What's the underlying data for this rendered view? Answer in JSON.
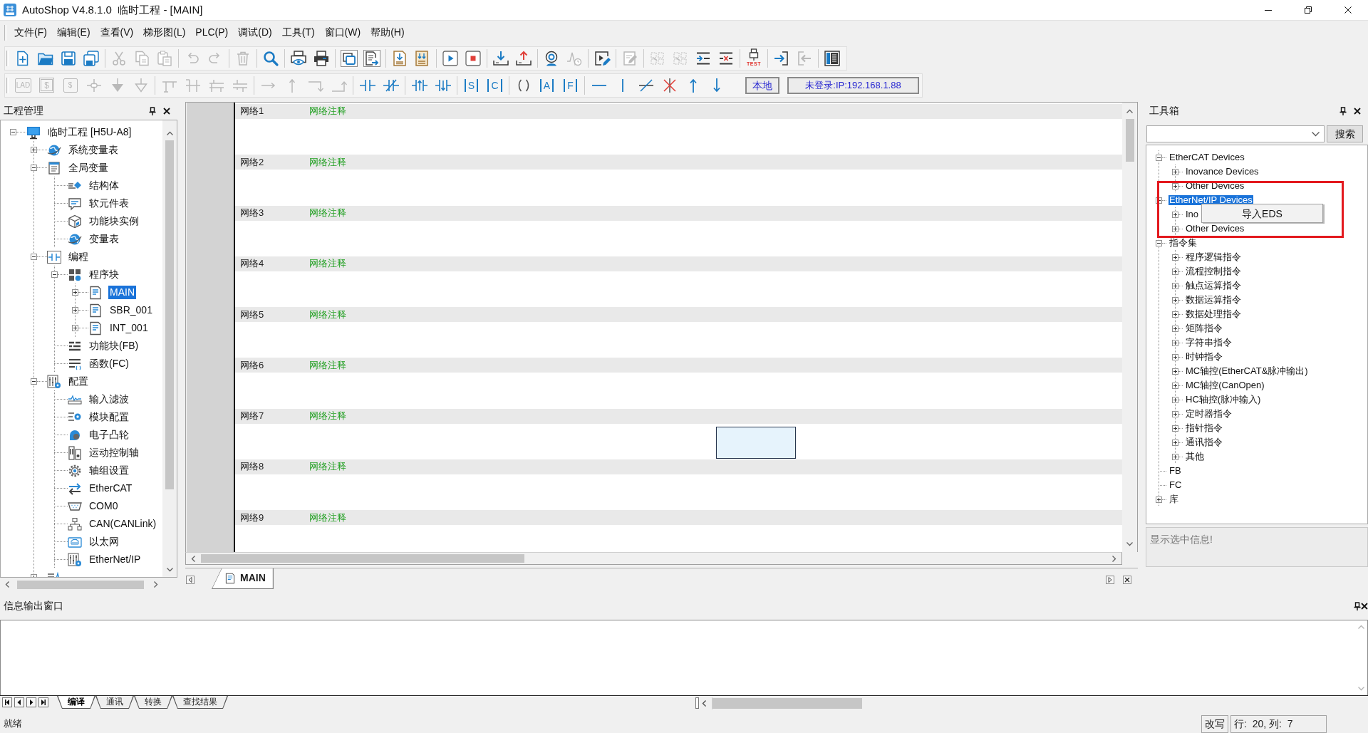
{
  "window": {
    "title": "AutoShop V4.8.1.0  临时工程 - [MAIN]"
  },
  "menu_bar": [
    "文件(F)",
    "编辑(E)",
    "查看(V)",
    "梯形图(L)",
    "PLC(P)",
    "调试(D)",
    "工具(T)",
    "窗口(W)",
    "帮助(H)"
  ],
  "toolbar_main": [
    [
      {
        "kind": "new",
        "disabled": false,
        "pressed": false
      },
      {
        "kind": "open",
        "disabled": false,
        "pressed": false
      },
      {
        "kind": "save",
        "disabled": false,
        "pressed": false
      },
      {
        "kind": "save_all",
        "disabled": false,
        "pressed": false
      }
    ],
    [
      {
        "kind": "cut",
        "disabled": true,
        "pressed": false
      },
      {
        "kind": "copy",
        "disabled": true,
        "pressed": false
      },
      {
        "kind": "paste",
        "disabled": true,
        "pressed": false
      }
    ],
    [
      {
        "kind": "undo",
        "disabled": true,
        "pressed": false
      },
      {
        "kind": "redo",
        "disabled": true,
        "pressed": false
      }
    ],
    [
      {
        "kind": "delete",
        "disabled": true,
        "pressed": false
      }
    ],
    [
      {
        "kind": "find",
        "disabled": false,
        "pressed": false
      }
    ],
    [
      {
        "kind": "print_preview",
        "disabled": false,
        "pressed": false
      },
      {
        "kind": "print",
        "disabled": false,
        "pressed": false
      }
    ],
    [
      {
        "kind": "windows",
        "disabled": false,
        "pressed": true
      },
      {
        "kind": "window_list",
        "disabled": false,
        "pressed": true
      }
    ],
    [
      {
        "kind": "import",
        "disabled": false,
        "pressed": false
      },
      {
        "kind": "compare",
        "disabled": false,
        "pressed": false
      }
    ],
    [
      {
        "kind": "run",
        "disabled": false,
        "pressed": false
      },
      {
        "kind": "stop",
        "disabled": false,
        "pressed": false
      }
    ],
    [
      {
        "kind": "download",
        "disabled": false,
        "pressed": false
      },
      {
        "kind": "upload",
        "disabled": false,
        "pressed": false
      }
    ],
    [
      {
        "kind": "monitor",
        "disabled": false,
        "pressed": false
      },
      {
        "kind": "trace",
        "disabled": true,
        "pressed": false
      }
    ],
    [
      {
        "kind": "online_edit",
        "disabled": false,
        "pressed": false
      }
    ],
    [
      {
        "kind": "comment",
        "disabled": true,
        "pressed": false
      }
    ],
    [
      {
        "kind": "grid",
        "disabled": true,
        "pressed": false
      },
      {
        "kind": "grid",
        "disabled": true,
        "pressed": false
      },
      {
        "kind": "insert_row",
        "disabled": false,
        "pressed": false
      },
      {
        "kind": "delete_row",
        "disabled": false,
        "pressed": false
      }
    ],
    [
      {
        "kind": "test",
        "label": "TEST",
        "disabled": false,
        "pressed": false
      }
    ],
    [
      {
        "kind": "login",
        "disabled": false,
        "pressed": false
      },
      {
        "kind": "logout",
        "disabled": true,
        "pressed": false
      }
    ],
    [
      {
        "kind": "panel",
        "disabled": false,
        "pressed": false
      }
    ]
  ],
  "toolbar_ladder": {
    "groups": [
      [
        {
          "kind": "boxed",
          "label": "LAD",
          "disabled": true
        },
        {
          "kind": "double_boxed",
          "label": "$",
          "disabled": true
        },
        {
          "kind": "boxed",
          "label": "$",
          "disabled": true
        },
        {
          "kind": "junction",
          "disabled": true
        },
        {
          "kind": "down_filled",
          "disabled": true
        },
        {
          "kind": "down_outline",
          "disabled": true
        }
      ],
      [
        {
          "kind": "branch_a",
          "disabled": true
        },
        {
          "kind": "branch_b",
          "disabled": true
        },
        {
          "kind": "branch_c",
          "disabled": true
        },
        {
          "kind": "branch_d",
          "disabled": true
        }
      ],
      [
        {
          "kind": "line_right",
          "disabled": true
        },
        {
          "kind": "line_up",
          "disabled": true
        },
        {
          "kind": "corner_down",
          "disabled": true
        },
        {
          "kind": "corner_up",
          "disabled": true
        }
      ],
      [
        {
          "kind": "contact",
          "disabled": false
        },
        {
          "kind": "contact_nc",
          "disabled": false
        }
      ],
      [
        {
          "kind": "rising",
          "disabled": false
        },
        {
          "kind": "falling",
          "disabled": false
        }
      ],
      [
        {
          "kind": "bracketed",
          "label": "S",
          "disabled": false
        },
        {
          "kind": "bracketed",
          "label": "C",
          "disabled": false
        }
      ],
      [
        {
          "kind": "coil",
          "disabled": false
        },
        {
          "kind": "bracketed",
          "label": "A",
          "disabled": false
        },
        {
          "kind": "bracketed",
          "label": "F",
          "disabled": false
        }
      ],
      [
        {
          "kind": "hline",
          "disabled": false
        },
        {
          "kind": "vline",
          "disabled": false
        },
        {
          "kind": "slash",
          "disabled": false
        },
        {
          "kind": "delete_line",
          "disabled": false
        },
        {
          "kind": "arrow_up",
          "disabled": false
        },
        {
          "kind": "arrow_down",
          "disabled": false
        }
      ]
    ],
    "location_button": "本地",
    "connection": "未登录:IP:192.168.1.88"
  },
  "project_panel": {
    "title": "工程管理",
    "tree": [
      {
        "label": "临时工程 [H5U-A8]",
        "kind": "project",
        "expanded": true,
        "selected": false,
        "children": [
          {
            "label": "系统变量表",
            "kind": "globe",
            "expanded": false,
            "selected": false
          },
          {
            "label": "全局变量",
            "kind": "variables",
            "expanded": true,
            "selected": false,
            "children": [
              {
                "label": "结构体",
                "kind": "struct",
                "selected": false
              },
              {
                "label": "软元件表",
                "kind": "devices",
                "selected": false
              },
              {
                "label": "功能块实例",
                "kind": "instance",
                "selected": false
              },
              {
                "label": "变量表",
                "kind": "globe",
                "selected": false
              }
            ]
          },
          {
            "label": "编程",
            "kind": "ladder",
            "expanded": true,
            "selected": false,
            "children": [
              {
                "label": "程序块",
                "kind": "blocks",
                "expanded": true,
                "selected": false,
                "children": [
                  {
                    "label": "MAIN",
                    "kind": "program",
                    "expanded": false,
                    "selected": true
                  },
                  {
                    "label": "SBR_001",
                    "kind": "program",
                    "expanded": false,
                    "selected": false
                  },
                  {
                    "label": "INT_001",
                    "kind": "program",
                    "expanded": false,
                    "selected": false
                  }
                ]
              },
              {
                "label": "功能块(FB)",
                "kind": "fb",
                "selected": false
              },
              {
                "label": "函数(FC)",
                "kind": "fc",
                "selected": false
              }
            ]
          },
          {
            "label": "配置",
            "kind": "config",
            "expanded": true,
            "selected": false,
            "children": [
              {
                "label": "输入滤波",
                "kind": "filter",
                "selected": false
              },
              {
                "label": "模块配置",
                "kind": "module",
                "selected": false
              },
              {
                "label": "电子凸轮",
                "kind": "cam",
                "selected": false
              },
              {
                "label": "运动控制轴",
                "kind": "axis",
                "selected": false
              },
              {
                "label": "轴组设置",
                "kind": "gear",
                "selected": false
              },
              {
                "label": "EtherCAT",
                "kind": "ethercat",
                "selected": false
              },
              {
                "label": "COM0",
                "kind": "serial",
                "selected": false
              },
              {
                "label": "CAN(CANLink)",
                "kind": "can",
                "selected": false
              },
              {
                "label": "以太网",
                "kind": "ethernet",
                "selected": false
              },
              {
                "label": "EtherNet/IP",
                "kind": "config",
                "selected": false
              }
            ]
          },
          {
            "kind": "watch",
            "expanded": false
          }
        ]
      }
    ]
  },
  "editor": {
    "networks": [
      {
        "label": "网络1",
        "comment": "网络注释",
        "cursor": false
      },
      {
        "label": "网络2",
        "comment": "网络注释",
        "cursor": false
      },
      {
        "label": "网络3",
        "comment": "网络注释",
        "cursor": false
      },
      {
        "label": "网络4",
        "comment": "网络注释",
        "cursor": false
      },
      {
        "label": "网络5",
        "comment": "网络注释",
        "cursor": false
      },
      {
        "label": "网络6",
        "comment": "网络注释",
        "cursor": false
      },
      {
        "label": "网络7",
        "comment": "网络注释",
        "cursor": true
      },
      {
        "label": "网络8",
        "comment": "网络注释",
        "cursor": false
      },
      {
        "label": "网络9",
        "comment": "网络注释",
        "cursor": false
      }
    ],
    "tabs": [
      {
        "label": "MAIN",
        "selected": true
      }
    ]
  },
  "toolbox": {
    "title": "工具箱",
    "search_button": "搜索",
    "tree": [
      {
        "label": "EtherCAT Devices",
        "expanded": true,
        "selected": false,
        "children": [
          {
            "label": "Inovance Devices",
            "expanded": false,
            "selected": false
          },
          {
            "label": "Other Devices",
            "expanded": false,
            "selected": false
          }
        ]
      },
      {
        "label": "EtherNet/IP Devices",
        "expanded": true,
        "selected": true,
        "children": [
          {
            "label": "Ino",
            "expanded": false,
            "selected": false
          },
          {
            "label": "Other Devices",
            "expanded": false,
            "selected": false
          }
        ]
      },
      {
        "label": "指令集",
        "expanded": true,
        "selected": false,
        "children": [
          {
            "label": "程序逻辑指令",
            "expanded": false,
            "selected": false
          },
          {
            "label": "流程控制指令",
            "expanded": false,
            "selected": false
          },
          {
            "label": "触点运算指令",
            "expanded": false,
            "selected": false
          },
          {
            "label": "数据运算指令",
            "expanded": false,
            "selected": false
          },
          {
            "label": "数据处理指令",
            "expanded": false,
            "selected": false
          },
          {
            "label": "矩阵指令",
            "expanded": false,
            "selected": false
          },
          {
            "label": "字符串指令",
            "expanded": false,
            "selected": false
          },
          {
            "label": "时钟指令",
            "expanded": false,
            "selected": false
          },
          {
            "label": "MC轴控(EtherCAT&脉冲输出)",
            "expanded": false,
            "selected": false
          },
          {
            "label": "MC轴控(CanOpen)",
            "expanded": false,
            "selected": false
          },
          {
            "label": "HC轴控(脉冲输入)",
            "expanded": false,
            "selected": false
          },
          {
            "label": "定时器指令",
            "expanded": false,
            "selected": false
          },
          {
            "label": "指针指令",
            "expanded": false,
            "selected": false
          },
          {
            "label": "通讯指令",
            "expanded": false,
            "selected": false
          },
          {
            "label": "其他",
            "expanded": false,
            "selected": false
          }
        ]
      },
      {
        "label": "FB",
        "selected": false
      },
      {
        "label": "FC",
        "selected": false
      },
      {
        "label": "库",
        "expanded": false,
        "selected": false
      }
    ],
    "context_menu": {
      "items": [
        "导入EDS"
      ]
    },
    "annotation": {
      "kind": "frame"
    },
    "info": "显示选中信息!"
  },
  "output_panel": {
    "title": "信息输出窗口",
    "tabs": [
      {
        "label": "编译",
        "selected": true
      },
      {
        "label": "通讯",
        "selected": false
      },
      {
        "label": "转换",
        "selected": false
      },
      {
        "label": "查找结果",
        "selected": false
      }
    ]
  },
  "status_bar": {
    "message": "就绪",
    "mode": "改写",
    "position": "行:  20, 列:  7"
  }
}
